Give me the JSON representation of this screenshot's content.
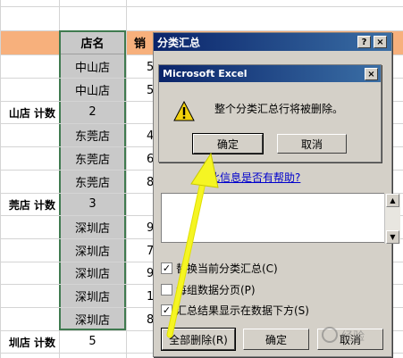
{
  "sheet": {
    "header": {
      "store_col": "店名",
      "sales_col_partial": "销"
    },
    "rows": [
      {
        "label": "",
        "value": "中山店",
        "num": "5"
      },
      {
        "label": "",
        "value": "中山店",
        "num": "5"
      },
      {
        "label": "山店  计数",
        "value": "2",
        "num": ""
      },
      {
        "label": "",
        "value": "东莞店",
        "num": "4"
      },
      {
        "label": "",
        "value": "东莞店",
        "num": "6"
      },
      {
        "label": "",
        "value": "东莞店",
        "num": "8"
      },
      {
        "label": "莞店  计数",
        "value": "3",
        "num": ""
      },
      {
        "label": "",
        "value": "深圳店",
        "num": "9"
      },
      {
        "label": "",
        "value": "深圳店",
        "num": "7"
      },
      {
        "label": "",
        "value": "深圳店",
        "num": "9"
      },
      {
        "label": "",
        "value": "深圳店",
        "num": "10"
      },
      {
        "label": "",
        "value": "深圳店",
        "num": "8"
      },
      {
        "label": "圳店  计数",
        "value": "5",
        "num": ""
      }
    ]
  },
  "subtotal_dialog": {
    "title": "分类汇总",
    "help_btn": "?",
    "close_btn": "×",
    "options": [
      {
        "label": "替换当前分类汇总(C)",
        "checked": true
      },
      {
        "label": "每组数据分页(P)",
        "checked": false
      },
      {
        "label": "汇总结果显示在数据下方(S)",
        "checked": true
      }
    ],
    "buttons": {
      "remove_all": "全部删除(R)",
      "ok": "确定",
      "cancel": "取消"
    },
    "help_link": "此信息是否有帮助?"
  },
  "message_box": {
    "title": "Microsoft Excel",
    "close_btn": "×",
    "text": "整个分类汇总行将被删除。",
    "ok": "确定",
    "cancel": "取消",
    "icon": "warning-icon"
  },
  "watermark": {
    "text": "经验"
  },
  "colors": {
    "header_band": "#f7b07c",
    "selection_border": "#3f7a4f",
    "title_bar": "#0a246a",
    "arrow": "#f5f523"
  }
}
